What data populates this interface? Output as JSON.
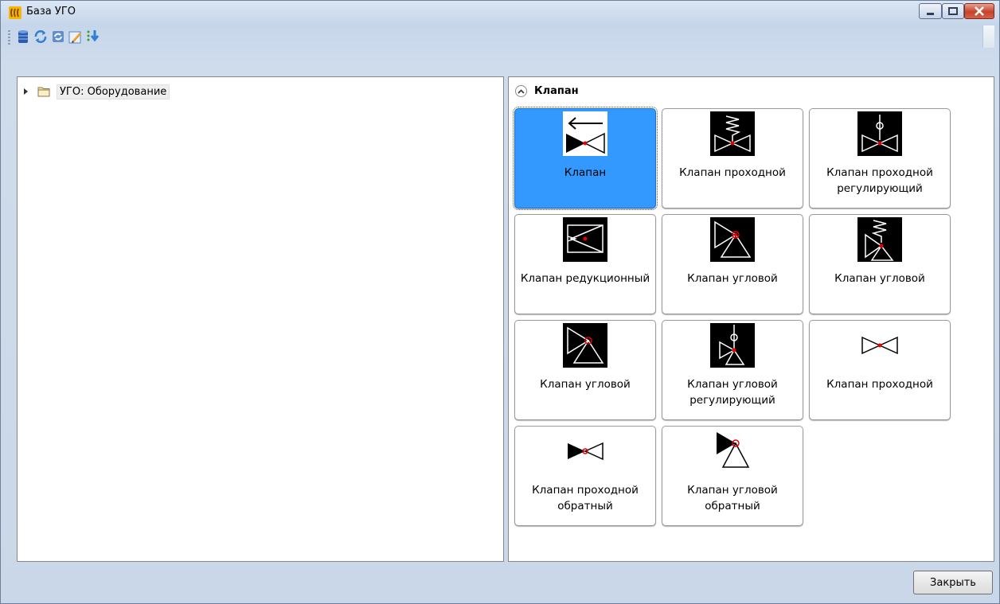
{
  "window": {
    "title": "База УГО",
    "app_icon": "app-logo-icon"
  },
  "title_controls": [
    "minimize-icon",
    "maximize-icon",
    "close-icon"
  ],
  "toolbar": {
    "buttons": [
      "database-icon",
      "refresh-icon",
      "sync-icon",
      "edit-icon",
      "sort-icon"
    ]
  },
  "tree": {
    "root_label": "УГО: Оборудование"
  },
  "group": {
    "title": "Клапан"
  },
  "tiles": [
    {
      "label": "Клапан",
      "icon": "valve-arrow-icon"
    },
    {
      "label": "Клапан проходной",
      "icon": "valve-spring-icon"
    },
    {
      "label": "Клапан проходной регулирующий",
      "icon": "valve-regulating-icon"
    },
    {
      "label": "Клапан редукционный",
      "icon": "valve-reducing-icon"
    },
    {
      "label": "Клапан угловой",
      "icon": "valve-angle-icon"
    },
    {
      "label": "Клапан угловой",
      "icon": "valve-angle-spring-icon"
    },
    {
      "label": "Клапан угловой",
      "icon": "valve-angle-icon"
    },
    {
      "label": "Клапан угловой регулирующий",
      "icon": "valve-angle-regulating-icon"
    },
    {
      "label": "Клапан проходной",
      "icon": "valve-straight-icon"
    },
    {
      "label": "Клапан проходной обратный",
      "icon": "valve-check-icon"
    },
    {
      "label": "Клапан угловой обратный",
      "icon": "valve-angle-check-icon"
    }
  ],
  "footer": {
    "close_label": "Закрыть"
  },
  "colors": {
    "selection": "#3399ff",
    "marker": "#e60000"
  }
}
